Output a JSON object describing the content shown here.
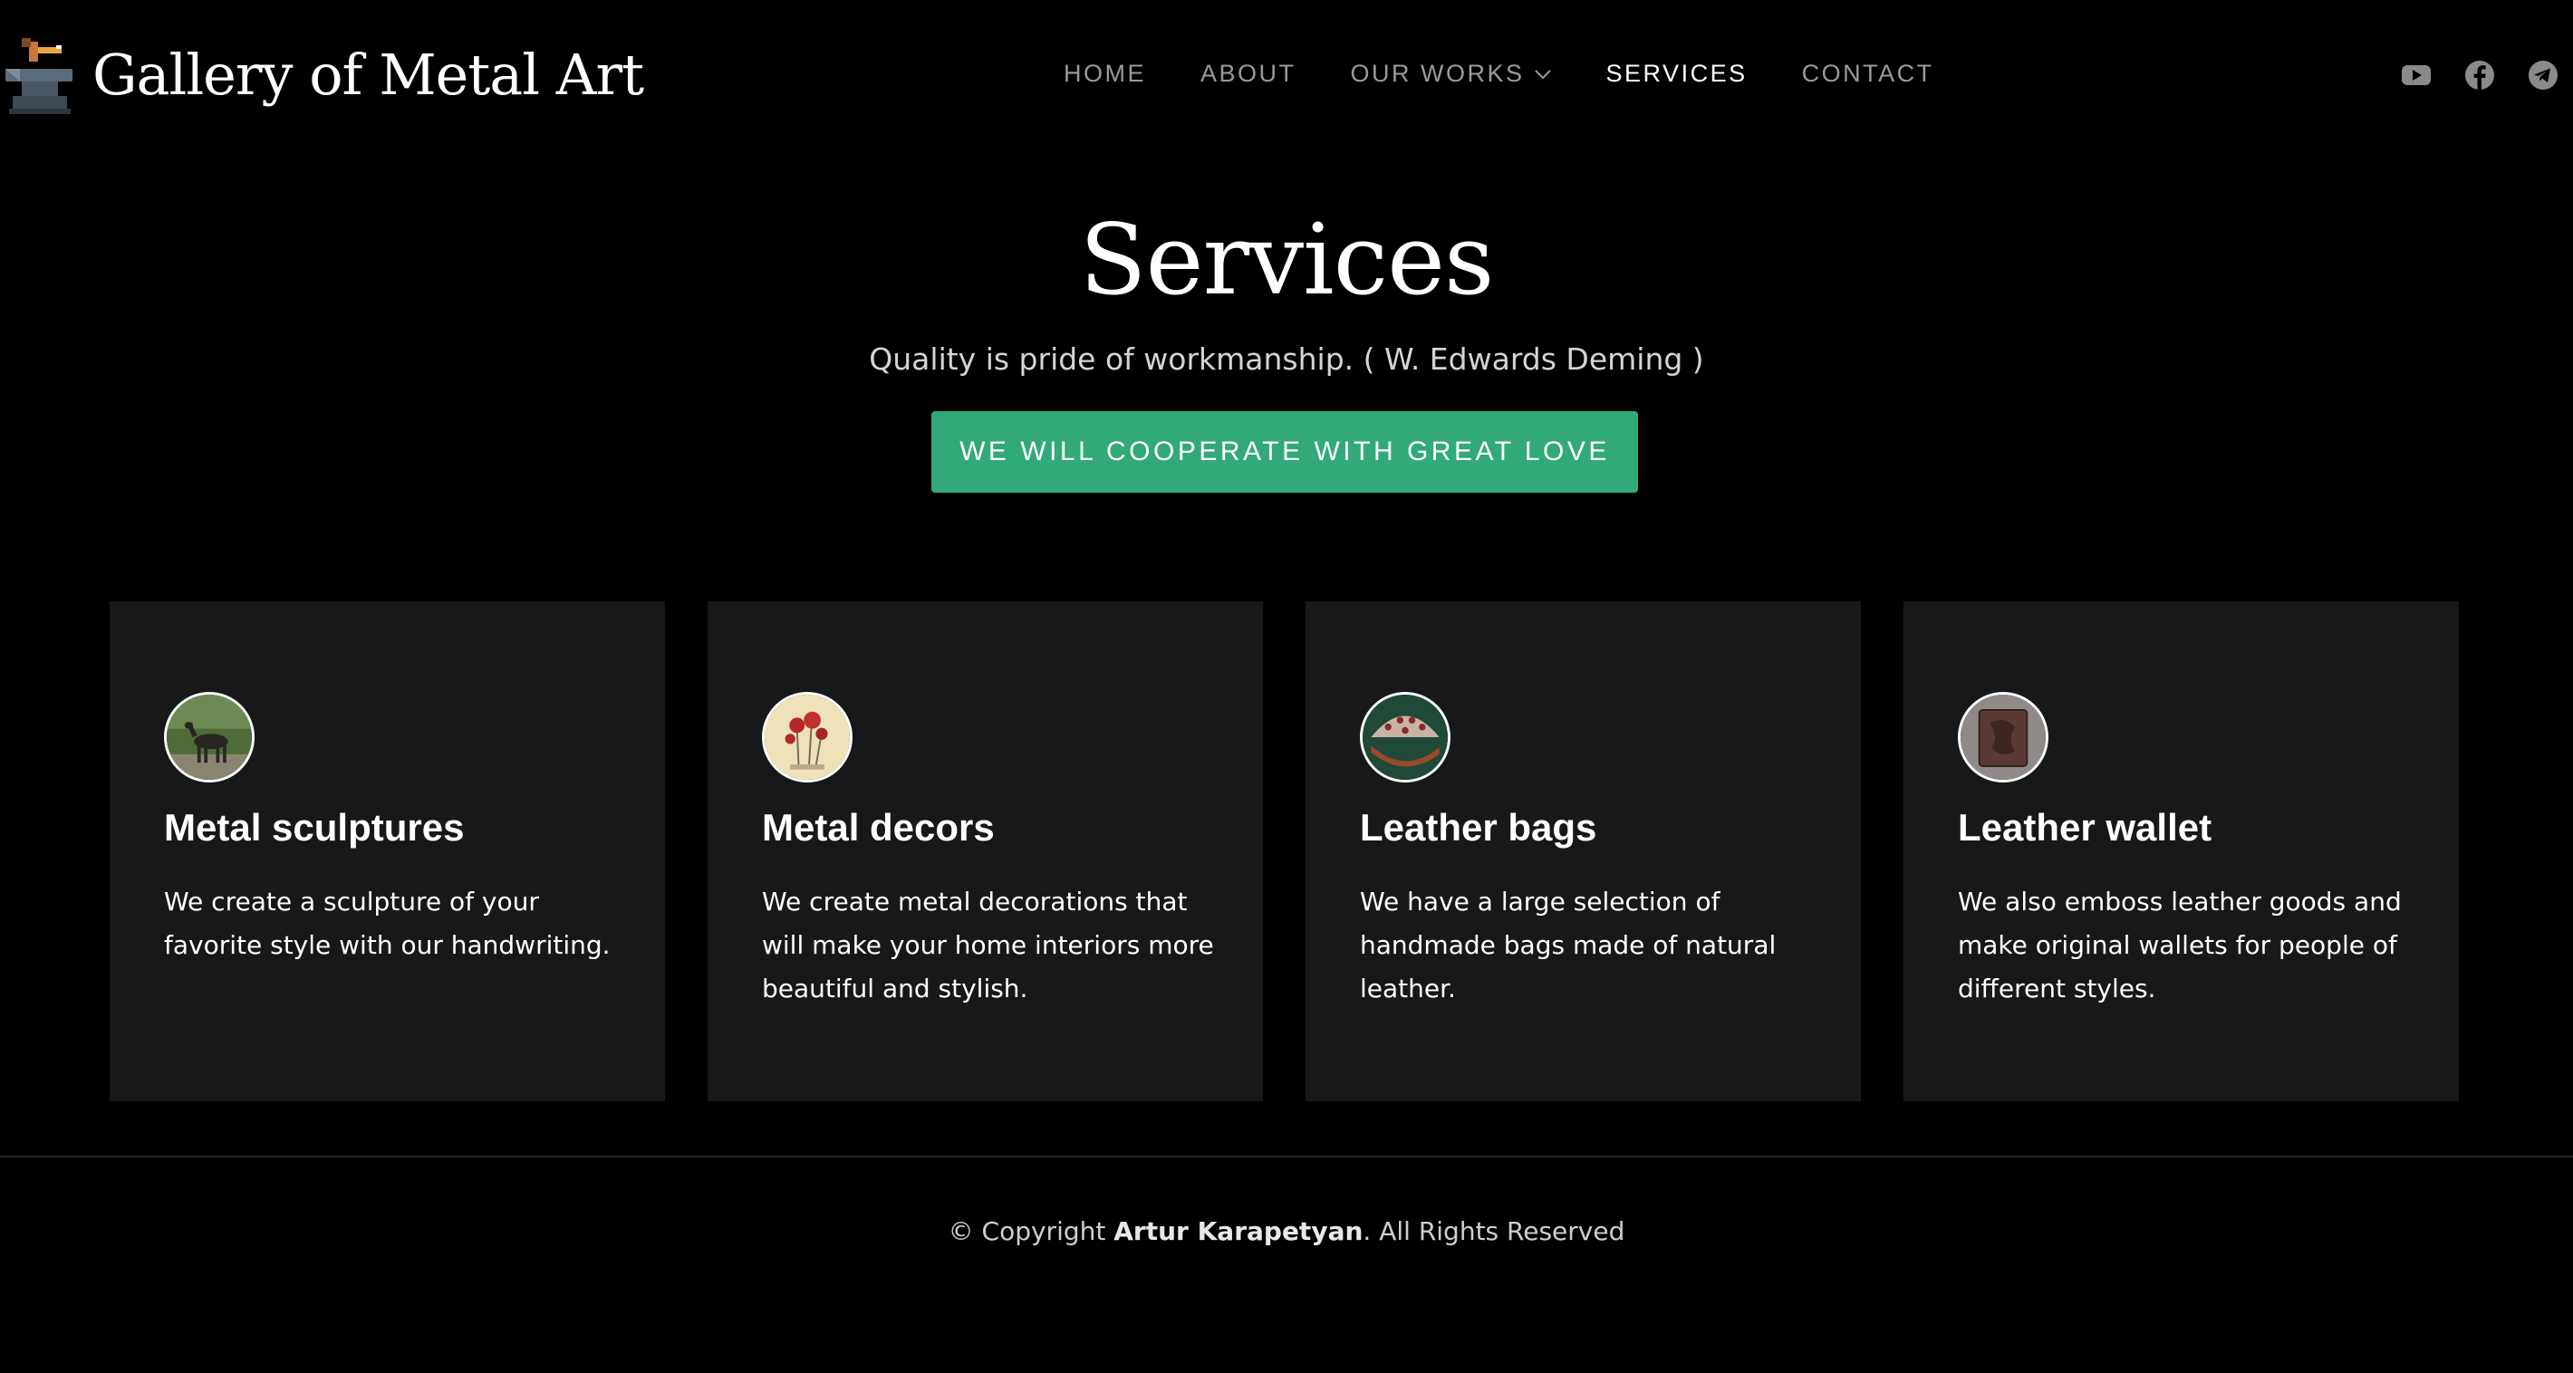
{
  "header": {
    "logo_text": "Gallery of Metal Art",
    "nav": [
      {
        "label": "HOME",
        "active": false
      },
      {
        "label": "ABOUT",
        "active": false
      },
      {
        "label": "OUR WORKS",
        "active": false,
        "has_dropdown": true
      },
      {
        "label": "SERVICES",
        "active": true
      },
      {
        "label": "CONTACT",
        "active": false
      }
    ],
    "social": [
      "youtube-icon",
      "facebook-icon",
      "telegram-icon"
    ]
  },
  "hero": {
    "title": "Services",
    "subtitle": "Quality is pride of workmanship. ( W. Edwards Deming )",
    "cta_label": "WE WILL COOPERATE WITH GREAT LOVE"
  },
  "services": [
    {
      "title": "Metal sculptures",
      "description": "We create a sculpture of your favorite style with our handwriting."
    },
    {
      "title": "Metal decors",
      "description": "We create metal decorations that will make your home interiors more beautiful and stylish."
    },
    {
      "title": "Leather bags",
      "description": "We have a large selection of handmade bags made of natural leather."
    },
    {
      "title": "Leather wallet",
      "description": "We also emboss leather goods and make original wallets for people of different styles."
    }
  ],
  "footer": {
    "prefix": "© Copyright ",
    "author": "Artur Karapetyan",
    "suffix": ". All Rights Reserved"
  },
  "colors": {
    "background": "#000000",
    "card_background": "#17181a",
    "accent": "#32a978",
    "nav_inactive": "#9a9a9a",
    "nav_active": "#ffffff"
  }
}
